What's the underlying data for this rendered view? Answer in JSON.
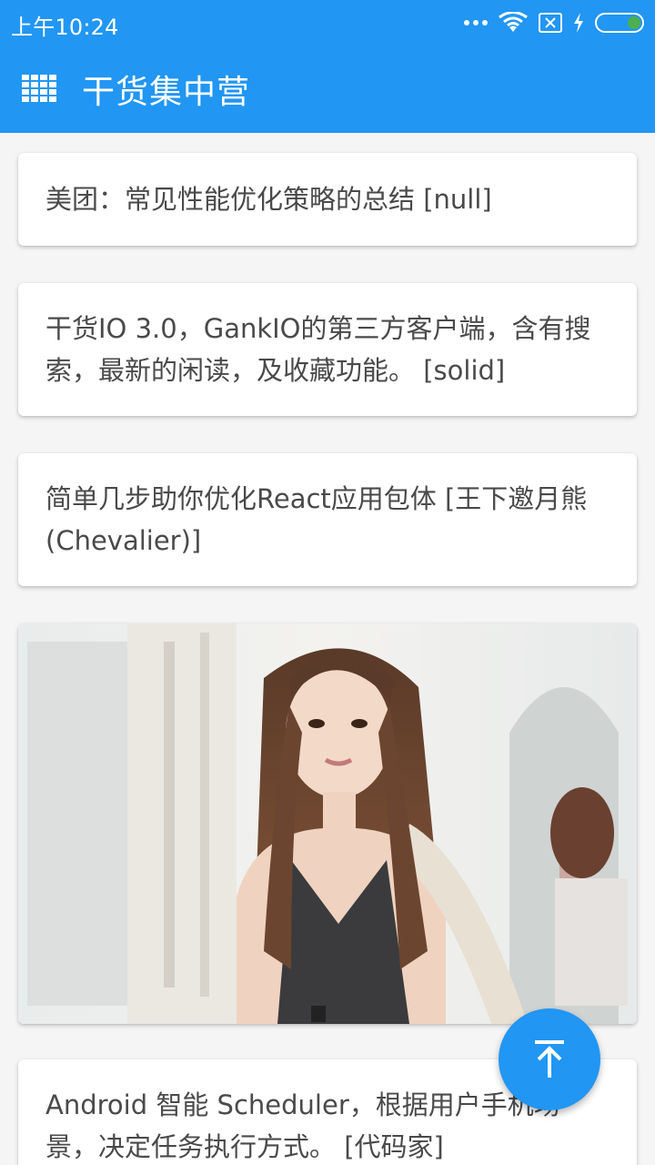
{
  "status_bar": {
    "time": "上午10:24"
  },
  "app_bar": {
    "title": "干货集中营",
    "menu_icon": "grid-menu-icon",
    "color": "#2196f3"
  },
  "feed": {
    "items": [
      {
        "type": "text",
        "text": "美团：常见性能优化策略的总结  [null]"
      },
      {
        "type": "text",
        "text": "干货IO 3.0，GankIO的第三方客户端，含有搜索，最新的闲读，及收藏功能。  [solid]"
      },
      {
        "type": "text",
        "text": "简单几步助你优化React应用包体  [王下邀月熊(Chevalier)]"
      },
      {
        "type": "image",
        "description": "photo"
      },
      {
        "type": "text",
        "text": "Android 智能 Scheduler，根据用户手机场景，决定任务执行方式。 [代码家]"
      }
    ]
  },
  "fab": {
    "icon": "arrow-up-to-top-icon"
  }
}
